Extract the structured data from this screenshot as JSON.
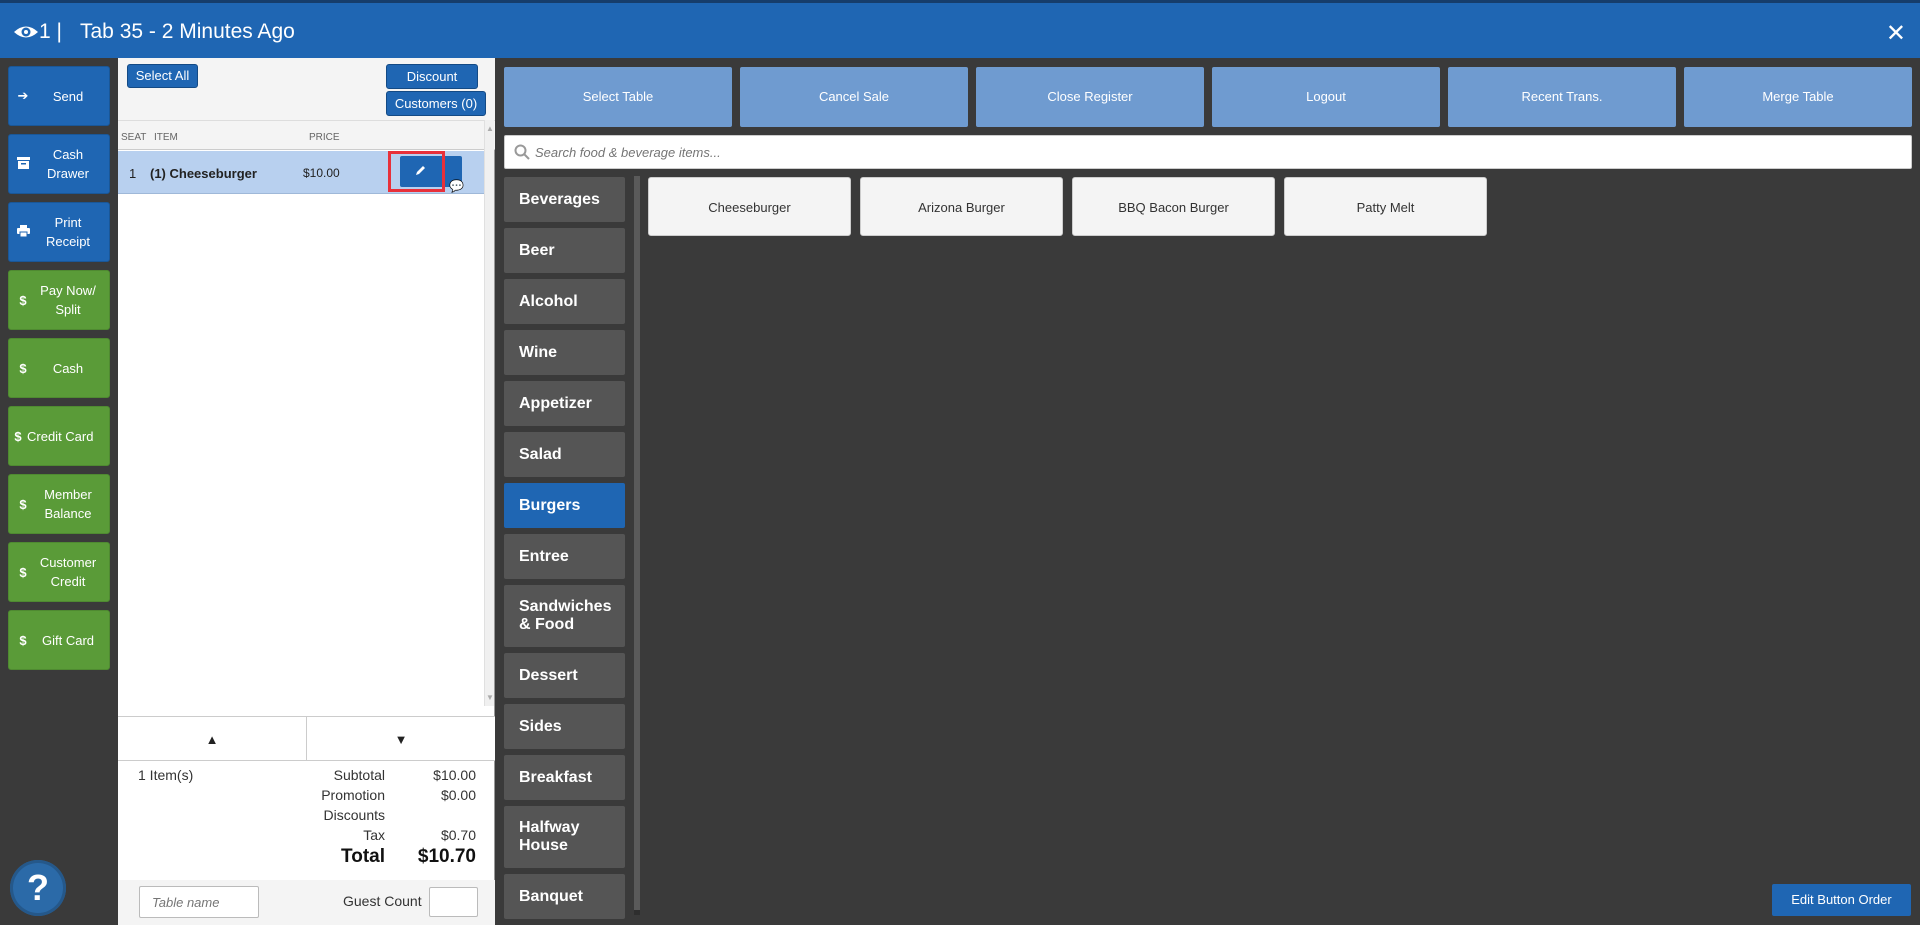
{
  "header": {
    "tab_number": "1 |",
    "title": "Tab 35 - 2 Minutes Ago",
    "close": "✕"
  },
  "left_buttons": [
    {
      "icon": "arrow-right-icon",
      "label": "Send",
      "color": "#1f66b3"
    },
    {
      "icon": "cash-drawer-icon",
      "label": "Cash Drawer",
      "color": "#1f66b3"
    },
    {
      "icon": "printer-icon",
      "label": "Print Receipt",
      "color": "#1f66b3"
    },
    {
      "icon": "dollar-icon",
      "label": "Pay Now/ Split",
      "color": "#5a9b38"
    },
    {
      "icon": "dollar-icon",
      "label": "Cash",
      "color": "#5a9b38"
    },
    {
      "icon": "dollar-icon",
      "label": "Credit Card",
      "color": "#5a9b38"
    },
    {
      "icon": "dollar-icon",
      "label": "Member Balance",
      "color": "#5a9b38"
    },
    {
      "icon": "dollar-icon",
      "label": "Customer Credit",
      "color": "#5a9b38"
    },
    {
      "icon": "dollar-icon",
      "label": "Gift Card",
      "color": "#5a9b38"
    }
  ],
  "help": {
    "label": "?"
  },
  "order": {
    "select_all": "Select All",
    "discount": "Discount",
    "customers": "Customers (0)",
    "columns": {
      "seat": "SEAT",
      "item": "ITEM",
      "price": "PRICE"
    },
    "rows": [
      {
        "seat": "1",
        "item": "(1) Cheeseburger",
        "price": "$10.00"
      }
    ],
    "item_count": "1 Item(s)",
    "totals": {
      "subtotal_label": "Subtotal",
      "subtotal": "$10.00",
      "promotion_label": "Promotion",
      "promotion": "$0.00",
      "discounts_label": "Discounts",
      "tax_label": "Tax",
      "tax": "$0.70",
      "total_label": "Total",
      "total": "$10.70"
    },
    "table_name_placeholder": "Table name",
    "guest_count_label": "Guest Count"
  },
  "toolbar": [
    "Select Table",
    "Cancel Sale",
    "Close Register",
    "Logout",
    "Recent Trans.",
    "Merge Table"
  ],
  "search": {
    "placeholder": "Search food & beverage items..."
  },
  "categories": [
    {
      "label": "Beverages",
      "active": false
    },
    {
      "label": "Beer",
      "active": false
    },
    {
      "label": "Alcohol",
      "active": false
    },
    {
      "label": "Wine",
      "active": false
    },
    {
      "label": "Appetizer",
      "active": false
    },
    {
      "label": "Salad",
      "active": false
    },
    {
      "label": "Burgers",
      "active": true
    },
    {
      "label": "Entree",
      "active": false
    },
    {
      "label": "Sandwiches & Food",
      "active": false
    },
    {
      "label": "Dessert",
      "active": false
    },
    {
      "label": "Sides",
      "active": false
    },
    {
      "label": "Breakfast",
      "active": false
    },
    {
      "label": "Halfway House",
      "active": false
    },
    {
      "label": "Banquet",
      "active": false
    }
  ],
  "items": [
    "Cheeseburger",
    "Arizona Burger",
    "BBQ Bacon Burger",
    "Patty Melt"
  ],
  "edit_button_order": "Edit Button Order",
  "colors": {
    "primary": "#1f66b3",
    "green": "#5a9b38",
    "toolbar": "#6f9bd0",
    "background": "#3a3a3a",
    "selected_row": "#b8d0ef",
    "highlight": "#e8303a"
  }
}
